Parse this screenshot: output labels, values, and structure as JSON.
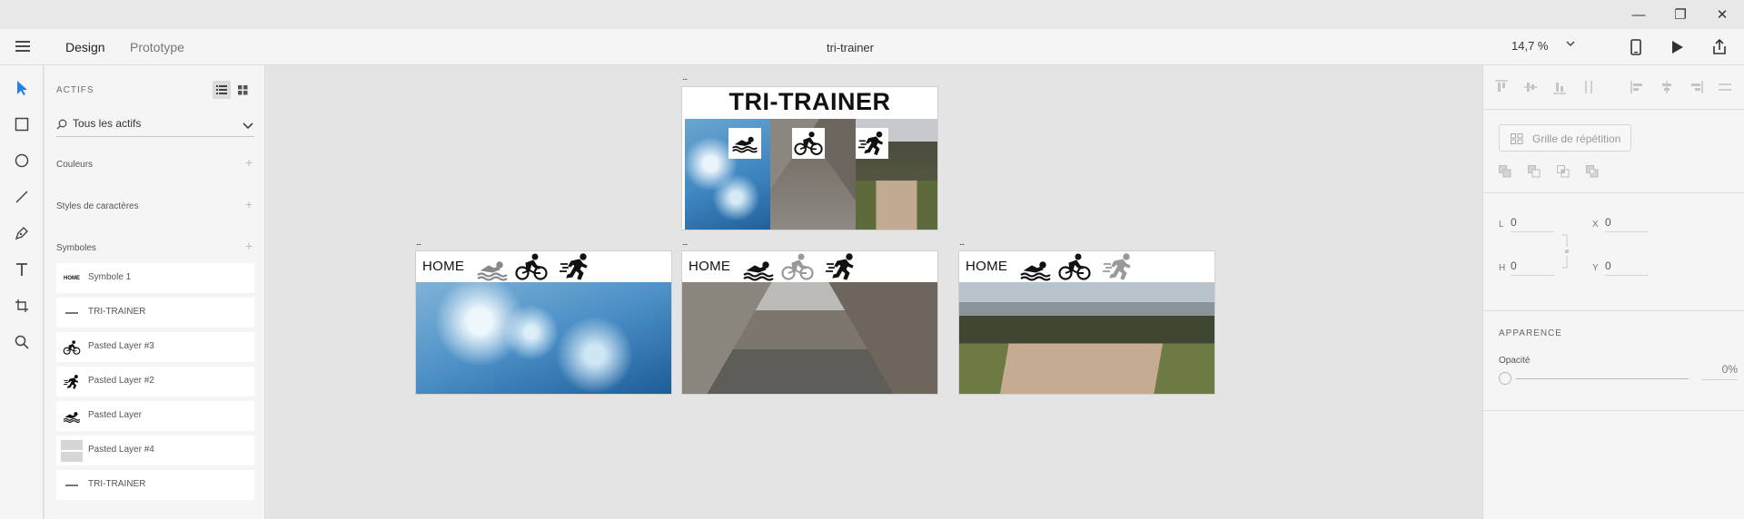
{
  "window": {
    "minimize_glyph": "—",
    "restore_glyph": "❐",
    "close_glyph": "✕"
  },
  "toolbar": {
    "tabs": [
      {
        "label": "Design"
      },
      {
        "label": "Prototype"
      }
    ],
    "document_title": "tri-trainer",
    "zoom": "14,7 %",
    "icons": [
      "mobile-preview-icon",
      "play-icon",
      "share-icon"
    ]
  },
  "tools": [
    "select-tool-icon",
    "rectangle-tool-icon",
    "ellipse-tool-icon",
    "line-tool-icon",
    "pen-tool-icon",
    "text-tool-icon",
    "artboard-tool-icon",
    "zoom-tool-icon"
  ],
  "assets": {
    "title": "ACTIFS",
    "filter": "Tous les actifs",
    "sections": {
      "colors": "Couleurs",
      "char_styles": "Styles de caractères",
      "symbols": "Symboles"
    },
    "symbols": [
      {
        "label": "Symbole 1",
        "thumb": "home-text"
      },
      {
        "label": "TRI-TRAINER",
        "thumb": "tiny-text"
      },
      {
        "label": "Pasted Layer #3",
        "thumb": "bike-icon"
      },
      {
        "label": "Pasted Layer #2",
        "thumb": "run-icon"
      },
      {
        "label": "Pasted Layer",
        "thumb": "swim-icon"
      },
      {
        "label": "Pasted Layer #4",
        "thumb": "gray-block"
      },
      {
        "label": "TRI-TRAINER",
        "thumb": "tiny-text"
      }
    ],
    "home_thumb_text": "HOME"
  },
  "canvas": {
    "title_artboard": {
      "title": "TRI-TRAINER"
    },
    "nav_label": "HOME",
    "artboards": [
      {
        "name": "swim",
        "active": "swim"
      },
      {
        "name": "bike",
        "active": "bike"
      },
      {
        "name": "run",
        "active": "run"
      }
    ],
    "dots": "..."
  },
  "properties": {
    "repeat_grid": "Grille de répétition",
    "dims": {
      "w_label": "L",
      "w": "0",
      "h_label": "H",
      "h": "0",
      "x_label": "X",
      "x": "0",
      "y_label": "Y",
      "y": "0"
    },
    "appearance": "APPARENCE",
    "opacity_label": "Opacité",
    "opacity_value": "0%"
  },
  "colors": {
    "accent": "#2680eb",
    "panel": "#f5f5f5",
    "canvas": "#e4e4e4"
  }
}
